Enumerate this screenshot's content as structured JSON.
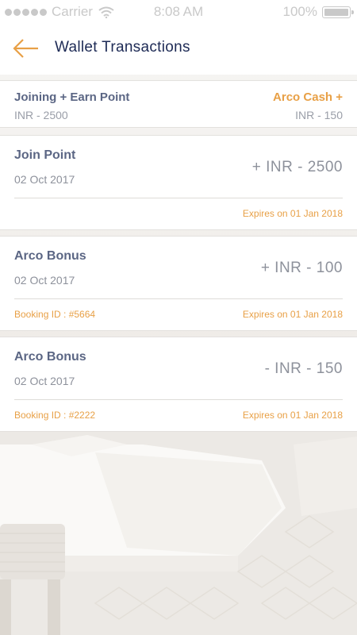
{
  "status_bar": {
    "carrier": "Carrier",
    "time": "8:08 AM",
    "battery": "100%"
  },
  "header": {
    "title": "Wallet Transactions",
    "accent_color": "#e8a046"
  },
  "summary": {
    "left_title": "Joining + Earn Point",
    "left_value": "INR - 2500",
    "right_title": "Arco Cash +",
    "right_value": "INR - 150"
  },
  "transactions": [
    {
      "title": "Join Point",
      "date": "02 Oct 2017",
      "amount": "+ INR - 2500",
      "booking": "",
      "expires": "Expires on 01 Jan 2018"
    },
    {
      "title": "Arco Bonus",
      "date": "02 Oct 2017",
      "amount": "+ INR - 100",
      "booking": "Booking ID : #5664",
      "expires": "Expires on 01 Jan 2018"
    },
    {
      "title": "Arco Bonus",
      "date": "02 Oct 2017",
      "amount": "- INR - 150",
      "booking": "Booking ID : #2222",
      "expires": "Expires on 01 Jan 2018"
    }
  ]
}
